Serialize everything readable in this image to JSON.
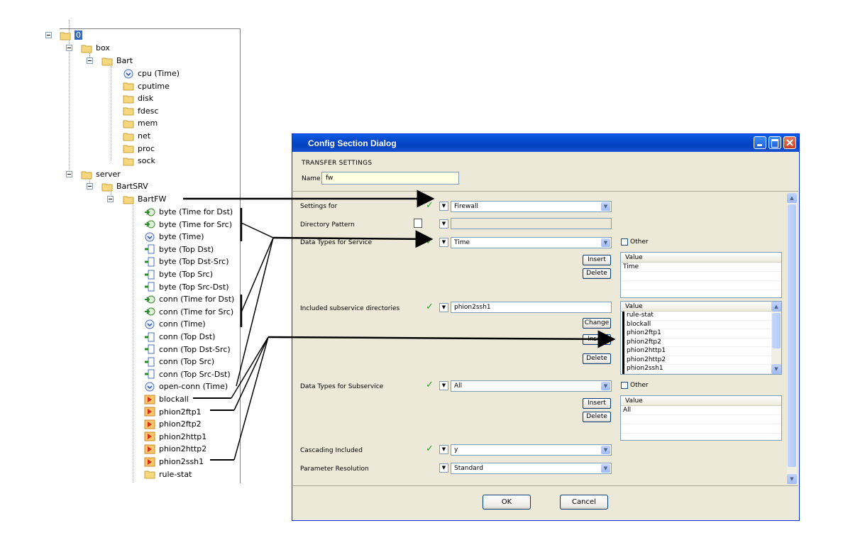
{
  "tree": {
    "root": "0",
    "box": "box",
    "bart": "Bart",
    "bart_children": [
      "cpu (Time)",
      "cputime",
      "disk",
      "fdesc",
      "mem",
      "net",
      "proc",
      "sock"
    ],
    "server": "server",
    "bartsrv": "BartSRV",
    "bartfw": "BartFW",
    "bartfw_children": [
      "byte (Time for Dst)",
      "byte (Time for Src)",
      "byte (Time)",
      "byte (Top Dst)",
      "byte (Top Dst-Src)",
      "byte (Top Src)",
      "byte (Top Src-Dst)",
      "conn (Time for Dst)",
      "conn (Time for Src)",
      "conn (Time)",
      "conn (Top Dst)",
      "conn (Top Dst-Src)",
      "conn (Top Src)",
      "conn (Top Src-Dst)",
      "open-conn (Time)",
      "blockall",
      "phion2ftp1",
      "phion2ftp2",
      "phion2http1",
      "phion2http2",
      "phion2ssh1",
      "rule-stat"
    ]
  },
  "dialog": {
    "title": "Config Section Dialog",
    "section": "TRANSFER SETTINGS",
    "name_label": "Name",
    "name_value": "fw",
    "settings_for_label": "Settings for",
    "settings_for_value": "Firewall",
    "directory_pattern_label": "Directory Pattern",
    "data_types_service_label": "Data Types for Service",
    "data_types_service_value": "Time",
    "other_label": "Other",
    "insert_label": "Insert",
    "delete_label": "Delete",
    "change_label": "Change",
    "value_header": "Value",
    "service_values": [
      "Time"
    ],
    "included_label": "Included subservice directories",
    "included_value": "phion2ssh1",
    "included_list": [
      "rule-stat",
      "blockall",
      "phion2ftp1",
      "phion2ftp2",
      "phion2http1",
      "phion2http2",
      "phion2ssh1"
    ],
    "data_types_subservice_label": "Data Types for Subservice",
    "data_types_subservice_value": "All",
    "subservice_values": [
      "All"
    ],
    "cascading_label": "Cascading Included",
    "cascading_value": "y",
    "param_res_label": "Parameter Resolution",
    "param_res_value": "Standard",
    "ok_label": "OK",
    "cancel_label": "Cancel"
  }
}
